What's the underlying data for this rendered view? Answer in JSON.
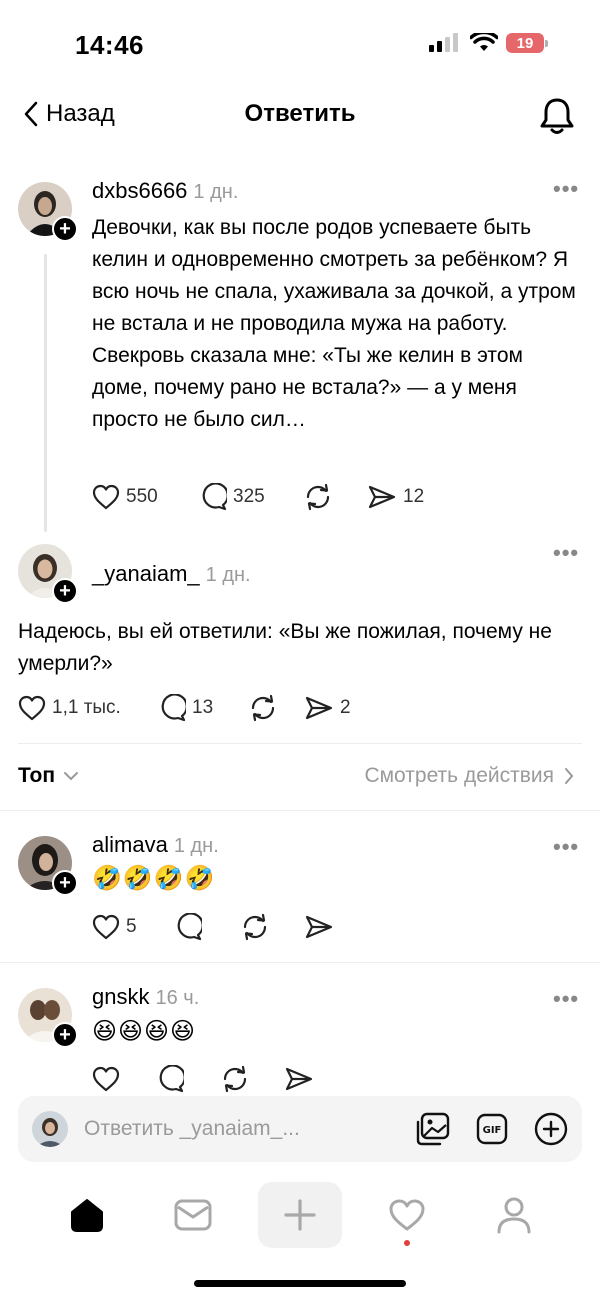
{
  "status": {
    "time": "14:46",
    "battery": "19"
  },
  "nav": {
    "back_label": "Назад",
    "title": "Ответить"
  },
  "post": {
    "username": "dxbs6666",
    "time": "1 дн.",
    "text": "Девочки, как вы после родов успеваете быть келин и одновременно смотреть за ребёнком? Я всю ночь не спала, ухаживала за дочкой, а утром не встала и не проводила мужа на работу. Свекровь сказала мне: «Ты же келин в этом доме, почему рано не встала?» — а у меня просто не было сил…",
    "likes": "550",
    "comments": "325",
    "shares": "12"
  },
  "reply_main": {
    "username": "_yanaiam_",
    "time": "1 дн.",
    "text": "Надеюсь, вы ей ответили: «Вы же пожилая, почему не умерли?»",
    "likes": "1,1 тыс.",
    "comments": "13",
    "shares": "2"
  },
  "sort": {
    "label": "Топ",
    "activity_link": "Смотреть действия"
  },
  "comments": [
    {
      "username": "alimava",
      "time": "1 дн.",
      "text": "🤣🤣🤣🤣",
      "likes": "5"
    },
    {
      "username": "gnskk",
      "time": "16 ч.",
      "text": "😆😆😆😆",
      "likes": ""
    }
  ],
  "reply_bar": {
    "placeholder": "Ответить _yanaiam_..."
  },
  "icons": {
    "back": "chevron-left-icon",
    "bell": "bell-icon",
    "like": "heart-icon",
    "comment": "comment-icon",
    "repost": "repost-icon",
    "share": "send-icon",
    "gallery": "gallery-icon",
    "gif": "gif-icon",
    "add": "plus-circle-icon",
    "home": "home-icon",
    "inbox": "mail-icon",
    "new_post": "plus-icon",
    "activity": "heart-icon",
    "profile": "profile-icon"
  },
  "colors": {
    "battery": "#e6676a",
    "notification_dot": "#e0403f",
    "muted": "#9a9a9a"
  }
}
